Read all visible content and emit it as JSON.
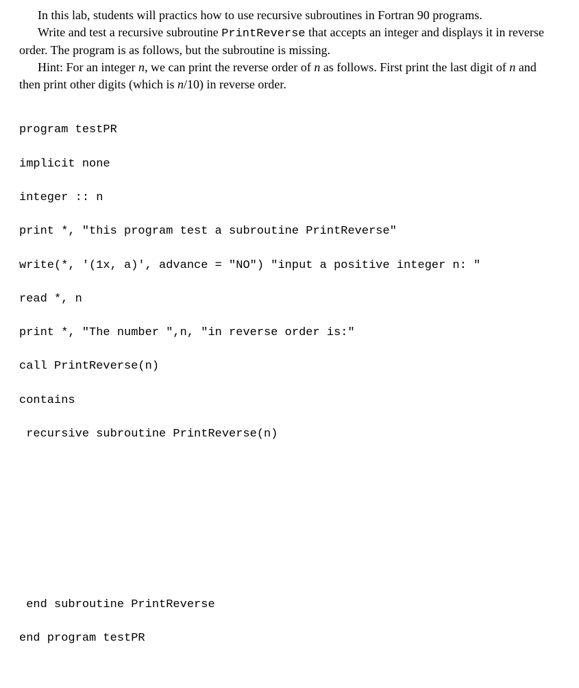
{
  "para1_a": "In this lab, students will practics how to use recursive subroutines in Fortran 90 programs.",
  "para2_a": "Write and test a recursive subroutine ",
  "para2_tt": "PrintReverse",
  "para2_b": " that accepts an integer and displays it in reverse order. The program is as follows, but the subroutine is missing.",
  "para3_a": "Hint: For an integer ",
  "varn1": "n",
  "para3_b": ", we can print the reverse order of ",
  "varn2": "n",
  "para3_c": " as follows. First print the last digit of ",
  "varn3": "n",
  "para3_d": " and then print other digits (which is ",
  "varn4": "n",
  "para3_e": "/10) in reverse order.",
  "code": {
    "l1": "program testPR",
    "l2": "implicit none",
    "l3": "integer :: n",
    "l4": "print *, \"this program test a subroutine PrintReverse\"",
    "l5": "write(*, '(1x, a)', advance = \"NO\") \"input a positive integer n: \"",
    "l6": "read *, n",
    "l7": "print *, \"The number \",n, \"in reverse order is:\"",
    "l8": "call PrintReverse(n)",
    "l9": "contains",
    "l10": " recursive subroutine PrintReverse(n)",
    "l11": " end subroutine PrintReverse",
    "l12": "end program testPR"
  }
}
